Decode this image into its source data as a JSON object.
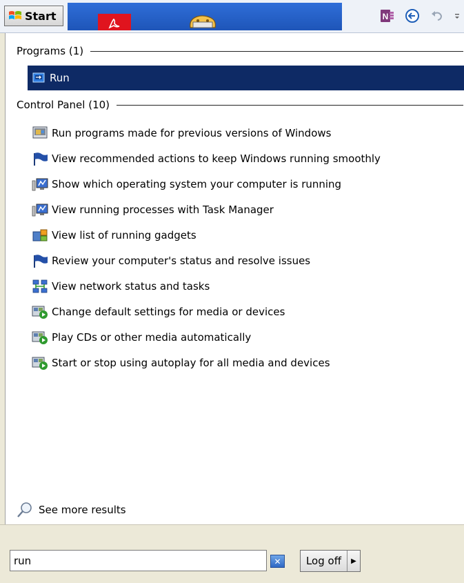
{
  "taskbar": {
    "start_label": "Start",
    "items": [
      "adobe-acrobat-icon",
      "printer-icon"
    ],
    "quick_access": [
      "onenote-icon",
      "back-arrow-icon",
      "undo-icon",
      "customize-dropdown-icon"
    ]
  },
  "menu": {
    "programs_header": "Programs (1)",
    "programs": [
      {
        "label": "Run",
        "icon": "run-icon"
      }
    ],
    "control_panel_header": "Control Panel (10)",
    "control_panel": [
      {
        "label": "Run programs made for previous versions of Windows",
        "icon": "compatibility-icon"
      },
      {
        "label": "View recommended actions to keep Windows running smoothly",
        "icon": "action-center-flag-icon"
      },
      {
        "label": "Show which operating system your computer is running",
        "icon": "system-monitor-icon"
      },
      {
        "label": "View running processes with Task Manager",
        "icon": "system-monitor-icon"
      },
      {
        "label": "View list of running gadgets",
        "icon": "gadgets-icon"
      },
      {
        "label": "Review your computer's status and resolve issues",
        "icon": "action-center-flag-icon"
      },
      {
        "label": "View network status and tasks",
        "icon": "network-icon"
      },
      {
        "label": "Change default settings for media or devices",
        "icon": "autoplay-icon"
      },
      {
        "label": "Play CDs or other media automatically",
        "icon": "autoplay-icon"
      },
      {
        "label": "Start or stop using autoplay for all media and devices",
        "icon": "autoplay-icon"
      }
    ],
    "see_more": "See more results"
  },
  "search": {
    "value": "run",
    "clear_label": "✕"
  },
  "logoff": {
    "label": "Log off",
    "arrow": "▶"
  },
  "colors": {
    "selection": "#0e2a65",
    "taskbar_strip": "#1e55b8",
    "menu_background": "#ffffff",
    "bottom_background": "#ece9d8"
  }
}
